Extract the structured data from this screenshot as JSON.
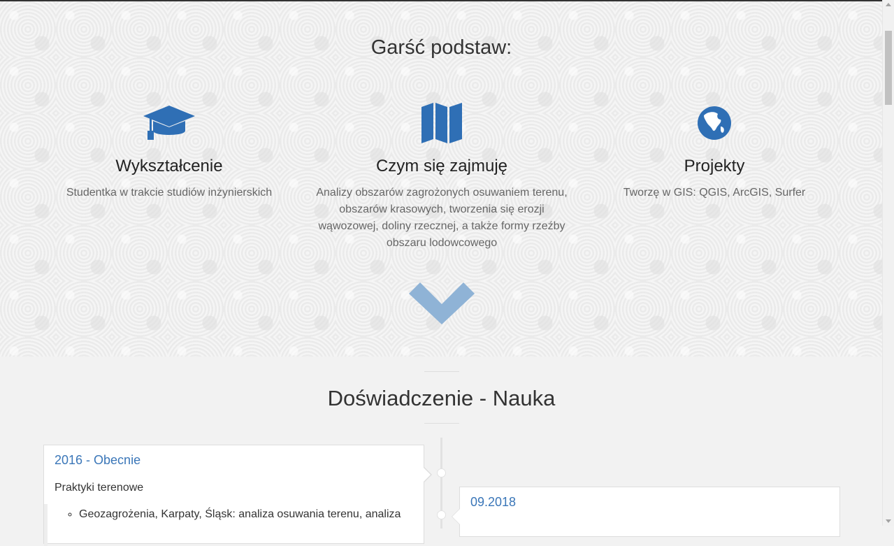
{
  "hero": {
    "title": "Garść podstaw:",
    "features": [
      {
        "icon": "graduation-cap-icon",
        "title": "Wykształcenie",
        "text": "Studentka w trakcie studiów inżynierskich"
      },
      {
        "icon": "map-icon",
        "title": "Czym się zajmuję",
        "text": "Analizy obszarów zagrożonych osuwaniem terenu, obszarów krasowych, tworzenia się erozji wąwozowej, doliny rzecznej, a także formy rzeźby obszaru lodowcowego"
      },
      {
        "icon": "globe-icon",
        "title": "Projekty",
        "text": "Tworzę w GIS: QGIS, ArcGIS, Surfer"
      }
    ],
    "scroll_icon": "chevron-down-icon"
  },
  "experience": {
    "title": "Doświadczenie - Nauka",
    "items": [
      {
        "date": "2016 - Obecnie",
        "subtitle": "Praktyki terenowe",
        "bullets": [
          "Geozagrożenia, Karpaty, Śląsk: analiza osuwania terenu, analiza"
        ]
      },
      {
        "date": "09.2018"
      }
    ]
  },
  "colors": {
    "accent": "#3a76b8",
    "icon": "#2f6fb5",
    "chevron": "#8fb3d6"
  }
}
